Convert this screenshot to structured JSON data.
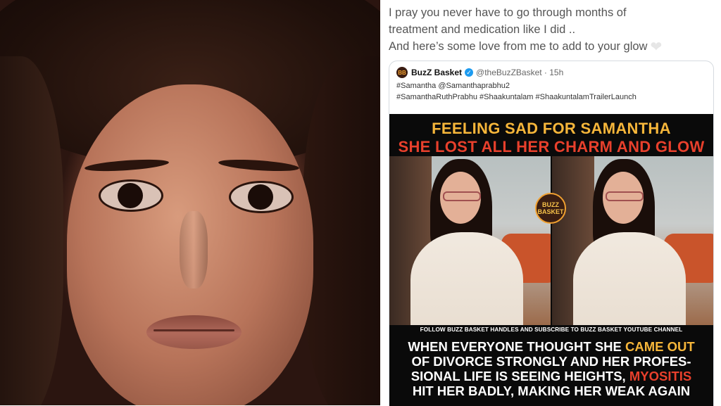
{
  "tweet": {
    "line1": "I pray you never have to go through months of",
    "line2": "treatment and medication like I did ..",
    "line3": "And here’s some love from me to add to your glow"
  },
  "quoted": {
    "avatar_text": "BB",
    "account_name": "BuzZ Basket",
    "handle": "@theBuzZBasket · 15h",
    "hashtags_line1": "#Samantha @Samanthaprabhu2",
    "hashtags_line2": "#SamanthaRuthPrabhu #Shaakuntalam #ShaakuntalamTrailerLaunch"
  },
  "meme": {
    "headline1": "FEELING SAD FOR SAMANTHA",
    "headline2": "SHE LOST ALL HER CHARM AND GLOW",
    "logo_text": "BUZZ BASKET",
    "follow_text": "FOLLOW BUZZ BASKET HANDLES AND SUBSCRIBE TO BUZZ BASKET YOUTUBE CHANNEL",
    "bottom_a": "WHEN EVERYONE THOUGHT SHE ",
    "bottom_b": "CAME OUT",
    "bottom_c": "OF DIVORCE STRONGLY AND HER PROFES-",
    "bottom_d": "SIONAL LIFE IS SEEING HEIGHTS, ",
    "bottom_e": "MYOSITIS",
    "bottom_f": "HIT HER BADLY, MAKING HER WEAK AGAIN"
  },
  "icons": [
    "heart-icon",
    "verified-icon"
  ],
  "colors": {
    "headline_yellow": "#f6b63a",
    "headline_red": "#e8402c",
    "verified_blue": "#1d9bf0"
  }
}
